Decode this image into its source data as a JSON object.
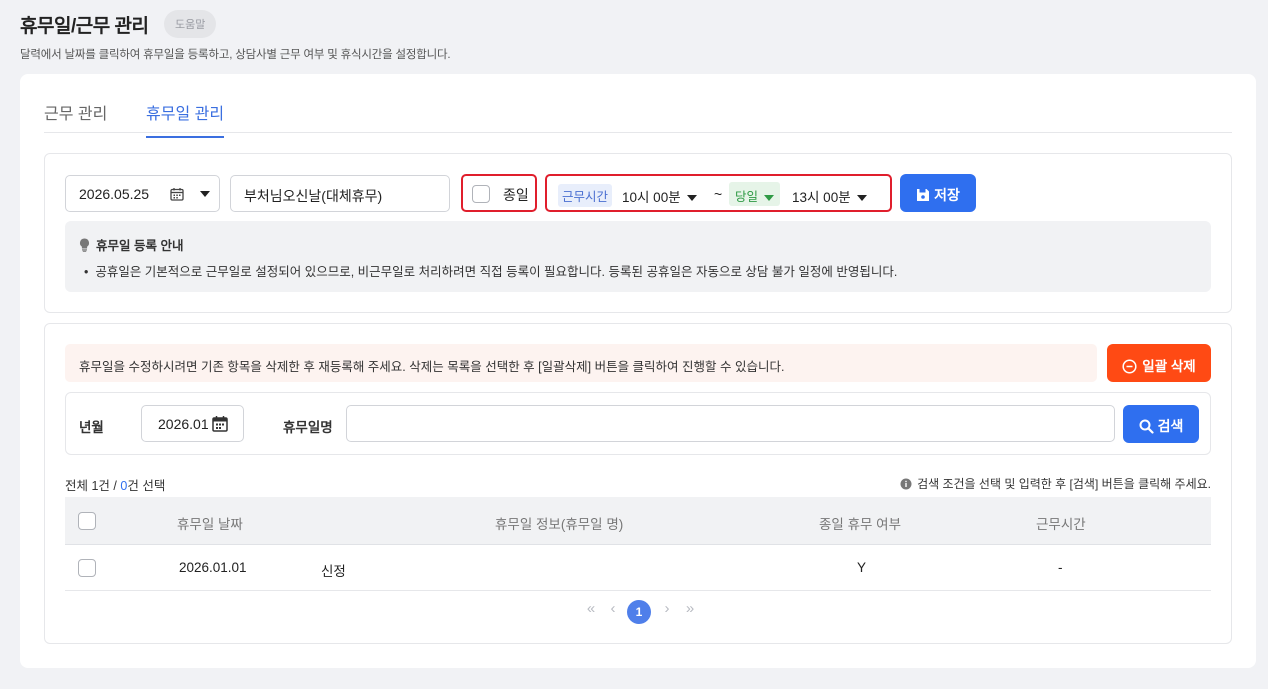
{
  "header": {
    "title": "휴무일/근무 관리",
    "help_label": "도움말",
    "description": "달력에서 날짜를 클릭하여 휴무일을 등록하고, 상담사별 근무 여부 및 휴식시간을 설정합니다."
  },
  "tabs": [
    {
      "label": "근무 관리",
      "active": false
    },
    {
      "label": "휴무일 관리",
      "active": true
    }
  ],
  "register": {
    "date": "2026.05.25",
    "holiday_name": "부처님오신날(대체휴무)",
    "allday_label": "종일",
    "allday_checked": false,
    "work_time_tag": "근무시간",
    "start_time": "10시 00분",
    "tilde": "~",
    "day_option": "당일",
    "end_time": "13시 00분",
    "save_label": "저장"
  },
  "notice": {
    "title": "휴무일 등록 안내",
    "text": "공휴일은 기본적으로 근무일로 설정되어 있으므로, 비근무일로 처리하려면 직접 등록이 필요합니다. 등록된 공휴일은 자동으로 상담 불가 일정에 반영됩니다."
  },
  "list": {
    "warning": "휴무일을 수정하시려면 기존 항목을 삭제한 후 재등록해 주세요. 삭제는 목록을 선택한 후 [일괄삭제] 버튼을 클릭하여 진행할 수 있습니다.",
    "bulk_delete_label": "일괄 삭제",
    "search": {
      "year_month_label": "년월",
      "year_month_value": "2026.01",
      "name_label": "휴무일명",
      "name_value": "",
      "search_label": "검색"
    },
    "count_total": "전체 1건",
    "count_sep": "/",
    "count_selected_num": "0",
    "count_selected_text": "건 선택",
    "hint": "검색 조건을 선택 및 입력한 후 [검색] 버튼을 클릭해 주세요.",
    "columns": [
      "휴무일 날짜",
      "휴무일 정보(휴무일 명)",
      "종일 휴무 여부",
      "근무시간"
    ],
    "rows": [
      {
        "date": "2026.01.01",
        "name": "신정",
        "allday": "Y",
        "work_time": "-"
      }
    ],
    "pagination": {
      "first": "«",
      "prev": "‹",
      "current": "1",
      "next": "›",
      "last": "»"
    }
  },
  "colors": {
    "primary": "#2f6fef",
    "danger": "#ff4a14",
    "highlight_border": "#e01e2c",
    "day_option_green": "#2f9a45"
  }
}
